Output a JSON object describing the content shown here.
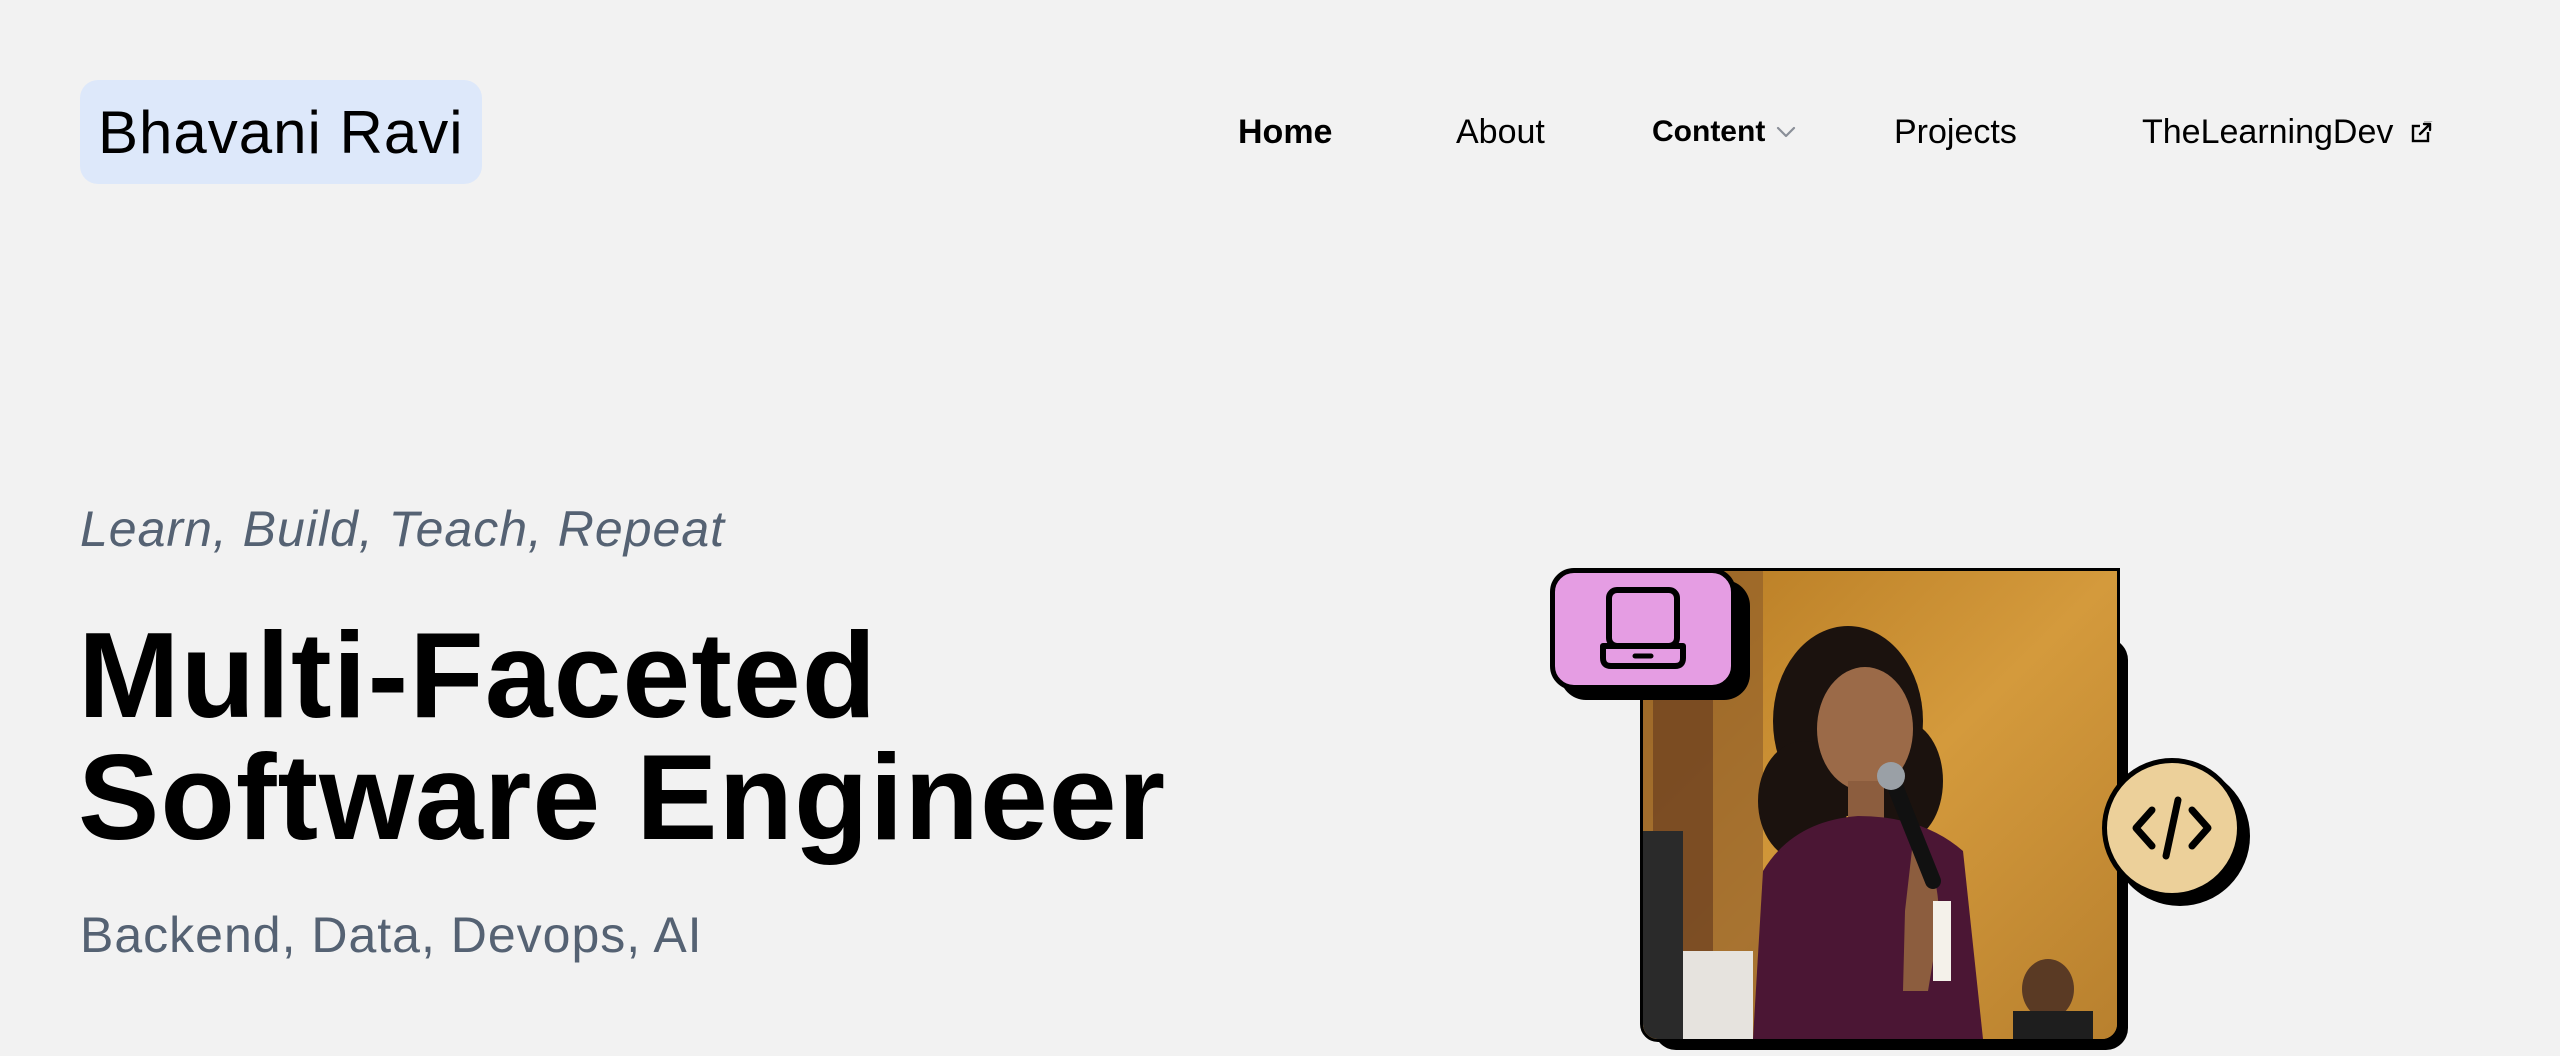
{
  "header": {
    "logo_text": "Bhavani Ravi",
    "nav": {
      "home": "Home",
      "about": "About",
      "content": "Content",
      "projects": "Projects",
      "the_learning_dev": "TheLearningDev"
    }
  },
  "hero": {
    "tagline": "Learn, Build, Teach, Repeat",
    "headline_line1": "Multi-Faceted",
    "headline_line2": "Software Engineer",
    "subhead": "Backend, Data, Devops, AI"
  },
  "icons": {
    "laptop": "laptop-icon",
    "code": "code-icon",
    "content_dropdown": "chevron-down-icon",
    "external_link": "external-link-icon"
  },
  "colors": {
    "background": "#f2f2f2",
    "logo_bg": "#dde8fa",
    "muted_text": "#556273",
    "laptop_badge": "#e59de3",
    "code_badge": "#ecd09a"
  }
}
